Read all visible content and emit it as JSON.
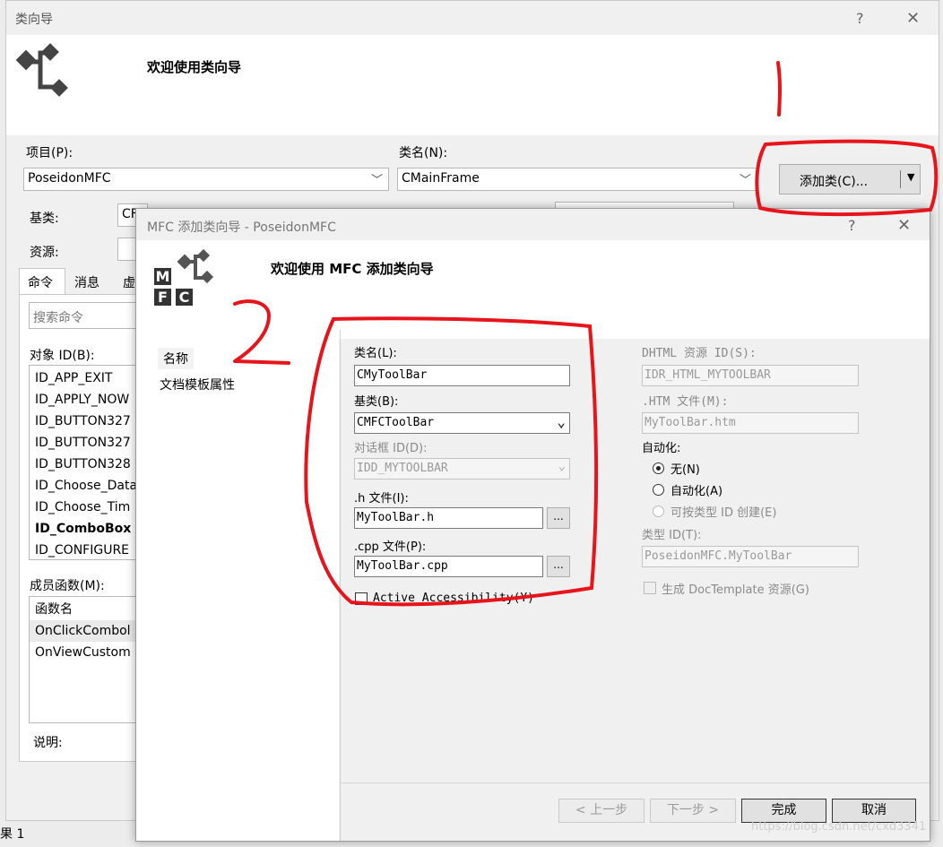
{
  "outer": {
    "title": "类向导",
    "help": "?",
    "close": "✕",
    "welcome": "欢迎使用类向导",
    "project_label": "项目(P):",
    "project_value": "PoseidonMFC",
    "classname_label": "类名(N):",
    "classname_value": "CMainFrame",
    "add_class_label": "添加类(C)...",
    "base_label": "基类:",
    "base_value": "CF",
    "resource_label": "资源:",
    "tabs": [
      "命令",
      "消息",
      "虚"
    ],
    "search_placeholder": "搜索命令",
    "objectid_label": "对象 ID(B):",
    "object_ids": [
      "ID_APP_EXIT",
      "ID_APPLY_NOW",
      "ID_BUTTON327",
      "ID_BUTTON327",
      "ID_BUTTON328",
      "ID_Choose_Data",
      "ID_Choose_Tim",
      "ID_ComboBox",
      "ID_CONFIGURE"
    ],
    "members_label": "成员函数(M):",
    "members_header": "函数名",
    "members": [
      "OnClickCombol",
      "OnViewCustom"
    ],
    "desc_label": "说明:",
    "status_text": "果 1"
  },
  "inner": {
    "title": "MFC 添加类向导 - PoseidonMFC",
    "help": "?",
    "close": "✕",
    "welcome": "欢迎使用 MFC 添加类向导",
    "nav": [
      "名称",
      "文档模板属性"
    ],
    "classname_label": "类名(L):",
    "classname_value": "CMyToolBar",
    "baseclass_label": "基类(B):",
    "baseclass_value": "CMFCToolBar",
    "dialogid_label": "对话框 ID(D):",
    "dialogid_value": "IDD_MYTOOLBAR",
    "hfile_label": ".h 文件(I):",
    "hfile_value": "MyToolBar.h",
    "cppfile_label": ".cpp 文件(P):",
    "cppfile_value": "MyToolBar.cpp",
    "browse": "...",
    "active_accessibility": "Active Accessibility(Y)",
    "dhtml_label": "DHTML 资源 ID(S):",
    "dhtml_value": "IDR_HTML_MYTOOLBAR",
    "htm_label": ".HTM 文件(M):",
    "htm_value": "MyToolBar.htm",
    "automation_label": "自动化:",
    "auto_options": [
      "无(N)",
      "自动化(A)",
      "可按类型 ID 创建(E)"
    ],
    "typeid_label": "类型 ID(T):",
    "typeid_value": "PoseidonMFC.MyToolBar",
    "doctemplate_label": "生成 DocTemplate 资源(G)",
    "prev_label": "< 上一步",
    "next_label": "下一步 >",
    "finish_label": "完成",
    "cancel_label": "取消"
  },
  "annotations": [
    "1",
    "2"
  ],
  "watermark": "https://blog.csdn.net/cxd3341",
  "colors": {
    "annotation": "#e8141c",
    "dialog_bg": "#f0f0f0",
    "header_bg": "#ffffff"
  }
}
